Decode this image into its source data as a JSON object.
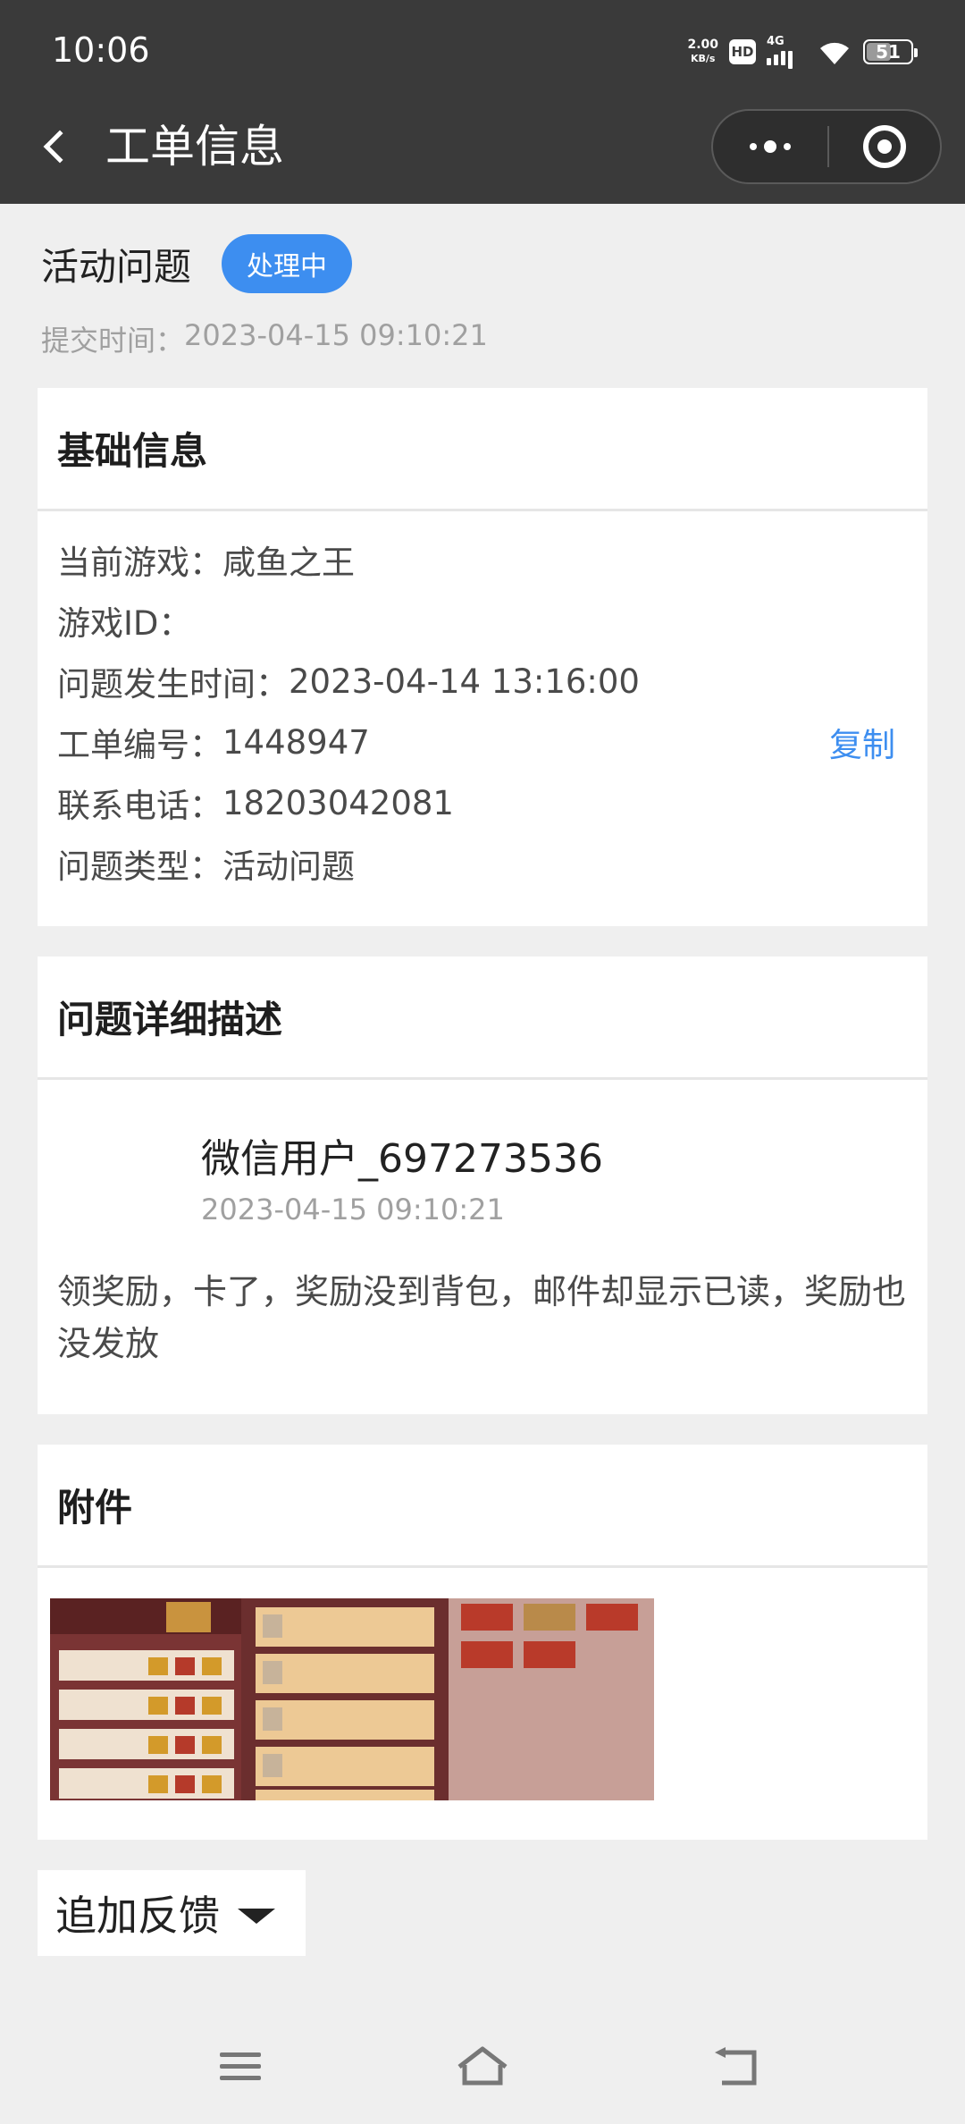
{
  "status_bar": {
    "time": "10:06",
    "net_speed_value": "2.00",
    "net_speed_unit": "KB/s",
    "hd": "HD",
    "network": "4G",
    "battery": "51"
  },
  "nav": {
    "title": "工单信息",
    "back_icon": "chevron-left-icon",
    "more_icon": "more-dots-icon",
    "close_icon": "target-ring-icon"
  },
  "ticket": {
    "title": "活动问题",
    "status": "处理中",
    "submit_label": "提交时间：",
    "submit_time": "2023-04-15 09:10:21"
  },
  "basic_info": {
    "heading": "基础信息",
    "rows": [
      {
        "label": "当前游戏：",
        "value": "咸鱼之王"
      },
      {
        "label": "游戏ID：",
        "value": ""
      },
      {
        "label": "问题发生时间：",
        "value": "2023-04-14 13:16:00"
      },
      {
        "label": "工单编号：",
        "value": "1448947"
      },
      {
        "label": "联系电话：",
        "value": "18203042081"
      },
      {
        "label": "问题类型：",
        "value": "活动问题"
      }
    ],
    "copy_label": "复制"
  },
  "description": {
    "heading": "问题详细描述",
    "user_name": "微信用户_697273536",
    "time": "2023-04-15 09:10:21",
    "text": "领奖励，卡了，奖励没到背包，邮件却显示已读，奖励也没发放"
  },
  "attachments": {
    "heading": "附件"
  },
  "feedback": {
    "label": "追加反馈"
  },
  "colors": {
    "accent": "#3d8ef0",
    "topbar": "#3a3a3a",
    "page_bg": "#efefef"
  }
}
